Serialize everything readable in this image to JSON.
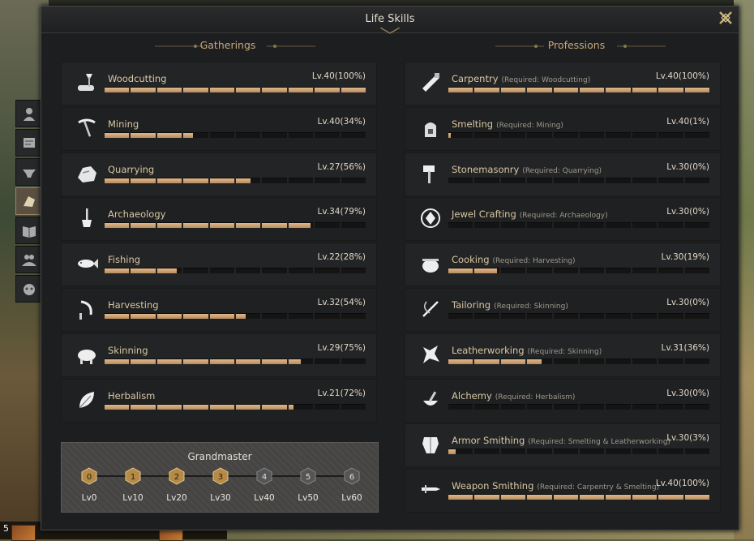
{
  "window": {
    "title": "Life Skills"
  },
  "gatherings": {
    "header": "Gatherings",
    "skills": [
      {
        "name": "Woodcutting",
        "level": "Lv.40",
        "pct": "(100%)",
        "progress": 100,
        "icon": "axe-log-icon"
      },
      {
        "name": "Mining",
        "level": "Lv.40",
        "pct": "(34%)",
        "progress": 34,
        "icon": "pickaxe-icon"
      },
      {
        "name": "Quarrying",
        "level": "Lv.27",
        "pct": "(56%)",
        "progress": 56,
        "icon": "stone-icon"
      },
      {
        "name": "Archaeology",
        "level": "Lv.34",
        "pct": "(79%)",
        "progress": 79,
        "icon": "shovel-icon"
      },
      {
        "name": "Fishing",
        "level": "Lv.22",
        "pct": "(28%)",
        "progress": 28,
        "icon": "fish-icon"
      },
      {
        "name": "Harvesting",
        "level": "Lv.32",
        "pct": "(54%)",
        "progress": 54,
        "icon": "sickle-icon"
      },
      {
        "name": "Skinning",
        "level": "Lv.29",
        "pct": "(75%)",
        "progress": 75,
        "icon": "boar-icon"
      },
      {
        "name": "Herbalism",
        "level": "Lv.21",
        "pct": "(72%)",
        "progress": 72,
        "icon": "leaf-icon"
      }
    ]
  },
  "professions": {
    "header": "Professions",
    "skills": [
      {
        "name": "Carpentry",
        "req": "(Required: Woodcutting)",
        "level": "Lv.40",
        "pct": "(100%)",
        "progress": 100,
        "icon": "saw-icon"
      },
      {
        "name": "Smelting",
        "req": "(Required: Mining)",
        "level": "Lv.40",
        "pct": "(1%)",
        "progress": 1,
        "icon": "furnace-icon"
      },
      {
        "name": "Stonemasonry",
        "req": "(Required: Quarrying)",
        "level": "Lv.30",
        "pct": "(0%)",
        "progress": 0,
        "icon": "hammer-icon"
      },
      {
        "name": "Jewel Crafting",
        "req": "(Required: Archaeology)",
        "level": "Lv.30",
        "pct": "(0%)",
        "progress": 0,
        "icon": "gem-icon"
      },
      {
        "name": "Cooking",
        "req": "(Required: Harvesting)",
        "level": "Lv.30",
        "pct": "(19%)",
        "progress": 19,
        "icon": "cauldron-icon"
      },
      {
        "name": "Tailoring",
        "req": "(Required: Skinning)",
        "level": "Lv.30",
        "pct": "(0%)",
        "progress": 0,
        "icon": "needle-icon"
      },
      {
        "name": "Leatherworking",
        "req": "(Required: Skinning)",
        "level": "Lv.31",
        "pct": "(36%)",
        "progress": 36,
        "icon": "hide-icon"
      },
      {
        "name": "Alchemy",
        "req": "(Required: Herbalism)",
        "level": "Lv.30",
        "pct": "(0%)",
        "progress": 0,
        "icon": "mortar-icon"
      },
      {
        "name": "Armor Smithing",
        "req": "(Required: Smelting & Leatherworking)",
        "level": "Lv.30",
        "pct": "(3%)",
        "progress": 3,
        "icon": "armor-icon"
      },
      {
        "name": "Weapon Smithing",
        "req": "(Required: Carpentry & Smelting)",
        "level": "Lv.40",
        "pct": "(100%)",
        "progress": 100,
        "icon": "sword-icon"
      }
    ]
  },
  "grandmaster": {
    "title": "Grandmaster",
    "tiers": [
      {
        "num": "0",
        "label": "Lv0",
        "unlocked": true
      },
      {
        "num": "1",
        "label": "Lv10",
        "unlocked": true
      },
      {
        "num": "2",
        "label": "Lv20",
        "unlocked": true
      },
      {
        "num": "3",
        "label": "Lv30",
        "unlocked": true
      },
      {
        "num": "4",
        "label": "Lv40",
        "unlocked": false
      },
      {
        "num": "5",
        "label": "Lv50",
        "unlocked": false
      },
      {
        "num": "6",
        "label": "Lv60",
        "unlocked": false
      }
    ]
  },
  "side_tabs": [
    {
      "icon": "character-bust-icon",
      "active": false
    },
    {
      "icon": "map-scroll-icon",
      "active": false
    },
    {
      "icon": "anvil-icon",
      "active": false
    },
    {
      "icon": "life-skills-icon",
      "active": true
    },
    {
      "icon": "book-icon",
      "active": false
    },
    {
      "icon": "party-icon",
      "active": false
    },
    {
      "icon": "pet-icon",
      "active": false
    }
  ],
  "hotbar": {
    "slot_number": "5"
  },
  "colors": {
    "accent": "#c8a87a",
    "bar_fill": "#c9a27a",
    "badge_unlocked": "#b58a46",
    "badge_locked": "#555555"
  }
}
